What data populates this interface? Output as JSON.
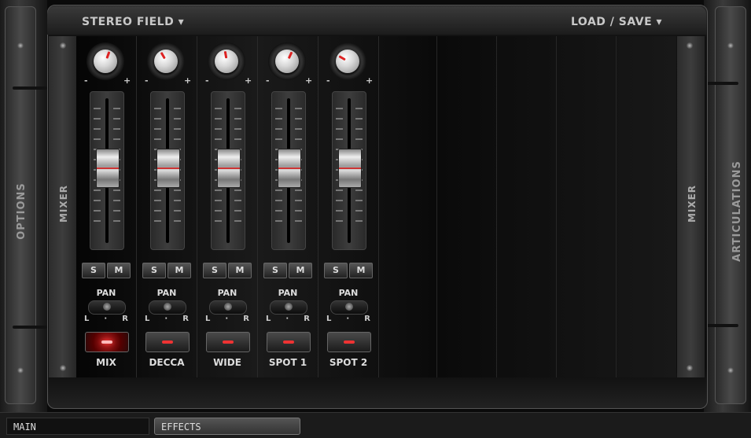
{
  "header": {
    "stereo_field_label": "STEREO FIELD ▾",
    "load_save_label": "LOAD  /  SAVE ▾"
  },
  "side_panels": {
    "options_label": "OPTIONS",
    "articulations_label": "ARTICULATIONS",
    "mixer_label_left": "MIXER",
    "mixer_label_right": "MIXER"
  },
  "channels": [
    {
      "name": "MIX",
      "solo": "S",
      "mute": "M",
      "pan_label": "PAN",
      "pan_l": "L",
      "pan_r": "R",
      "minus": "-",
      "plus": "+",
      "active": true
    },
    {
      "name": "DECCA",
      "solo": "S",
      "mute": "M",
      "pan_label": "PAN",
      "pan_l": "L",
      "pan_r": "R",
      "minus": "-",
      "plus": "+",
      "active": false
    },
    {
      "name": "WIDE",
      "solo": "S",
      "mute": "M",
      "pan_label": "PAN",
      "pan_l": "L",
      "pan_r": "R",
      "minus": "-",
      "plus": "+",
      "active": false
    },
    {
      "name": "SPOT 1",
      "solo": "S",
      "mute": "M",
      "pan_label": "PAN",
      "pan_l": "L",
      "pan_r": "R",
      "minus": "-",
      "plus": "+",
      "active": false
    },
    {
      "name": "SPOT 2",
      "solo": "S",
      "mute": "M",
      "pan_label": "PAN",
      "pan_l": "L",
      "pan_r": "R",
      "minus": "-",
      "plus": "+",
      "active": false
    }
  ],
  "bottom_tabs": {
    "main": "MAIN",
    "effects": "EFFECTS"
  },
  "colors": {
    "accent_red": "#dd2222",
    "led_active": "#ff4444"
  }
}
